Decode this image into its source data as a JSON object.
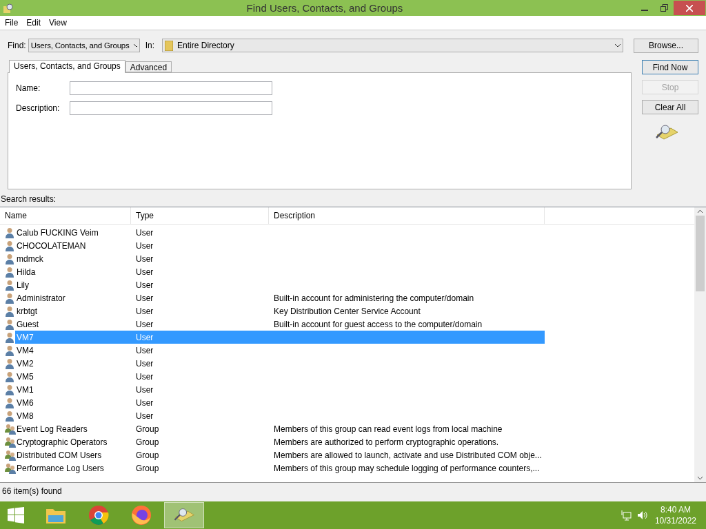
{
  "window": {
    "title": "Find Users, Contacts, and Groups"
  },
  "menu": [
    "File",
    "Edit",
    "View"
  ],
  "find": {
    "label": "Find:",
    "value": "Users, Contacts, and Groups",
    "in_label": "In:",
    "in_value": "Entire Directory",
    "browse": "Browse..."
  },
  "tabs": [
    {
      "label": "Users, Contacts, and Groups",
      "selected": true
    },
    {
      "label": "Advanced",
      "selected": false
    }
  ],
  "fields": [
    {
      "label": "Name:"
    },
    {
      "label": "Description:"
    }
  ],
  "buttons": [
    {
      "label": "Find Now",
      "disabled": false,
      "default": true
    },
    {
      "label": "Stop",
      "disabled": true,
      "default": false
    },
    {
      "label": "Clear All",
      "disabled": false,
      "default": false
    }
  ],
  "results_label": "Search results:",
  "table": {
    "columns": [
      "Name",
      "Type",
      "Description"
    ],
    "rows": [
      {
        "kind": "user",
        "name": "Calub FUCKING Veim",
        "type": "User",
        "description": "",
        "selected": false
      },
      {
        "kind": "user",
        "name": "CHOCOLATEMAN",
        "type": "User",
        "description": "",
        "selected": false
      },
      {
        "kind": "user",
        "name": "mdmck",
        "type": "User",
        "description": "",
        "selected": false
      },
      {
        "kind": "user",
        "name": "Hilda",
        "type": "User",
        "description": "",
        "selected": false
      },
      {
        "kind": "user",
        "name": "Lily",
        "type": "User",
        "description": "",
        "selected": false
      },
      {
        "kind": "user",
        "name": "Administrator",
        "type": "User",
        "description": "Built-in account for administering the computer/domain",
        "selected": false
      },
      {
        "kind": "user",
        "name": "krbtgt",
        "type": "User",
        "description": "Key Distribution Center Service Account",
        "selected": false
      },
      {
        "kind": "user",
        "name": "Guest",
        "type": "User",
        "description": "Built-in account for guest access to the computer/domain",
        "selected": false
      },
      {
        "kind": "user",
        "name": "VM7",
        "type": "User",
        "description": "",
        "selected": true
      },
      {
        "kind": "user",
        "name": "VM4",
        "type": "User",
        "description": "",
        "selected": false
      },
      {
        "kind": "user",
        "name": "VM2",
        "type": "User",
        "description": "",
        "selected": false
      },
      {
        "kind": "user",
        "name": "VM5",
        "type": "User",
        "description": "",
        "selected": false
      },
      {
        "kind": "user",
        "name": "VM1",
        "type": "User",
        "description": "",
        "selected": false
      },
      {
        "kind": "user",
        "name": "VM6",
        "type": "User",
        "description": "",
        "selected": false
      },
      {
        "kind": "user",
        "name": "VM8",
        "type": "User",
        "description": "",
        "selected": false
      },
      {
        "kind": "group",
        "name": "Event Log Readers",
        "type": "Group",
        "description": "Members of this group can read event logs from local machine",
        "selected": false
      },
      {
        "kind": "group",
        "name": "Cryptographic Operators",
        "type": "Group",
        "description": "Members are authorized to perform cryptographic operations.",
        "selected": false
      },
      {
        "kind": "group",
        "name": "Distributed COM Users",
        "type": "Group",
        "description": "Members are allowed to launch, activate and use Distributed COM obje...",
        "selected": false
      },
      {
        "kind": "group",
        "name": "Performance Log Users",
        "type": "Group",
        "description": "Members of this group may schedule logging of performance counters,...",
        "selected": false
      }
    ]
  },
  "status_bar": "66 item(s) found",
  "taskbar": {
    "apps": [
      {
        "kind": "explorer",
        "selected": false
      },
      {
        "kind": "chrome",
        "selected": false
      },
      {
        "kind": "firefox",
        "selected": false
      },
      {
        "kind": "find",
        "selected": true
      }
    ],
    "time": "8:40 AM",
    "date": "10/31/2022"
  }
}
